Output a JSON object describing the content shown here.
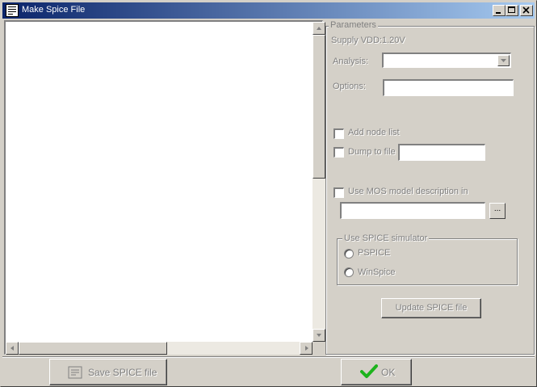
{
  "window": {
    "title": "Make Spice File",
    "icon": "spice-file-icon"
  },
  "title_buttons": {
    "minimize_icon": "minimize-icon",
    "maximize_icon": "maximize-icon",
    "close_icon": "close-icon"
  },
  "parameters": {
    "group_label": "Parameters",
    "supply": "Supply VDD:1.20V",
    "analysis_label": "Analysis:",
    "analysis_value": "",
    "options_label": "Options:",
    "options_value": "",
    "add_node_list": "Add node list",
    "dump_to_file": "Dump to file",
    "dump_file_value": "",
    "use_mos_model": "Use MOS model description in",
    "model_path_value": "",
    "browse_label": "...",
    "simulator_group": "Use SPICE simulator",
    "simulators": [
      "PSPICE",
      "WinSpice"
    ],
    "update_button": "Update SPICE file"
  },
  "footer": {
    "save_button": "Save SPICE file",
    "ok_button": "OK"
  },
  "colors": {
    "titlebar_start": "#0a246a",
    "titlebar_end": "#a6caf0",
    "face": "#d4d0c8",
    "disabled_text": "#808080",
    "ok_check": "#1db31d"
  }
}
